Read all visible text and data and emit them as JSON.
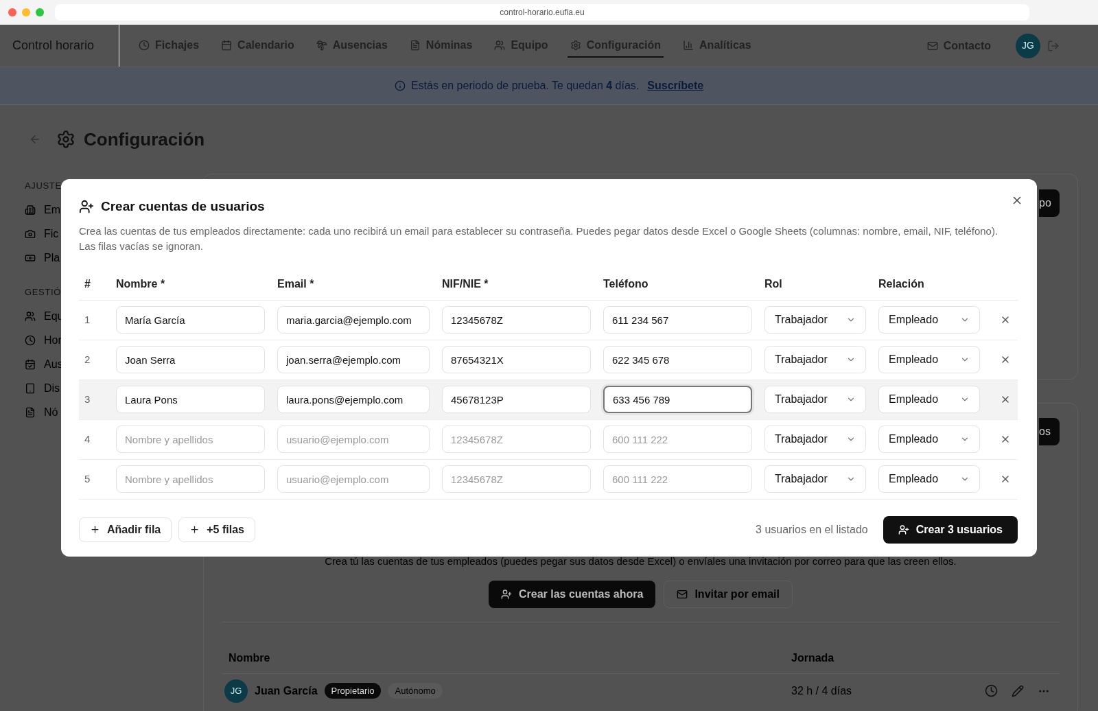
{
  "browser": {
    "url": "control-horario.eufia.eu"
  },
  "nav": {
    "brand": "Control horario",
    "items": [
      {
        "label": "Fichajes",
        "selected": false
      },
      {
        "label": "Calendario",
        "selected": false
      },
      {
        "label": "Ausencias",
        "selected": false
      },
      {
        "label": "Nóminas",
        "selected": false
      },
      {
        "label": "Equipo",
        "selected": false
      },
      {
        "label": "Configuración",
        "selected": true
      },
      {
        "label": "Analíticas",
        "selected": false
      }
    ],
    "contact": "Contacto",
    "avatar": "JG"
  },
  "banner": {
    "text": "Estás en periodo de prueba. Te quedan **4** días.",
    "link": "Suscríbete"
  },
  "page": {
    "title": "Configuración"
  },
  "sidebar": {
    "sections": [
      {
        "heading": "AJUSTE",
        "items": [
          "Em",
          "Fic",
          "Pla"
        ]
      },
      {
        "heading": "GESTIÓ",
        "items": [
          "Equ",
          "Hor",
          "Aus",
          "Dis",
          "Nó"
        ]
      }
    ]
  },
  "background_cards": [
    {
      "button": "po"
    },
    {
      "button": "os"
    }
  ],
  "team_section": {
    "description": "Crea tú las cuentas de tus empleados (puedes pegar sus datos desde Excel) o envíales una invitación por correo para que las creen ellos.",
    "buttons": [
      {
        "label": "Crear las cuentas ahora",
        "kind": "primary"
      },
      {
        "label": "Invitar por email",
        "kind": "secondary"
      }
    ],
    "columns": [
      "Nombre",
      "Jornada"
    ],
    "rows": [
      {
        "avatar": "JG",
        "name": "Juan García",
        "badges": [
          {
            "label": "Propietario",
            "kind": "dark"
          },
          {
            "label": "Autónomo",
            "kind": "light"
          }
        ],
        "jornada": "32 h / 4 días"
      }
    ]
  },
  "dialog": {
    "title": "Crear cuentas de usuarios",
    "description": "Crea las cuentas de tus empleados directamente: cada uno recibirá un email para establecer su contraseña. Puedes pegar datos desde Excel o Google Sheets (columnas: nombre, email, NIF, teléfono). Las filas vacías se ignoran.",
    "columns": [
      "#",
      "Nombre *",
      "Email *",
      "NIF/NIE *",
      "Teléfono",
      "Rol",
      "Relación"
    ],
    "rows": [
      {
        "number": "1",
        "highlighted": false,
        "nombre": {
          "value": "María García"
        },
        "email": {
          "value": "maria.garcia@ejemplo.com"
        },
        "nif": {
          "value": "12345678Z"
        },
        "telefono": {
          "value": "611 234 567",
          "focused": false
        },
        "rol": "Trabajador",
        "relacion": "Empleado"
      },
      {
        "number": "2",
        "highlighted": false,
        "nombre": {
          "value": "Joan Serra"
        },
        "email": {
          "value": "joan.serra@ejemplo.com"
        },
        "nif": {
          "value": "87654321X"
        },
        "telefono": {
          "value": "622 345 678",
          "focused": false
        },
        "rol": "Trabajador",
        "relacion": "Empleado"
      },
      {
        "number": "3",
        "highlighted": true,
        "nombre": {
          "value": "Laura Pons"
        },
        "email": {
          "value": "laura.pons@ejemplo.com"
        },
        "nif": {
          "value": "45678123P"
        },
        "telefono": {
          "value": "633 456 789",
          "focused": true
        },
        "rol": "Trabajador",
        "relacion": "Empleado"
      },
      {
        "number": "4",
        "highlighted": false,
        "nombre": {
          "placeholder": "Nombre y apellidos"
        },
        "email": {
          "placeholder": "usuario@ejemplo.com"
        },
        "nif": {
          "placeholder": "12345678Z"
        },
        "telefono": {
          "placeholder": "600 111 222",
          "focused": false
        },
        "rol": "Trabajador",
        "relacion": "Empleado"
      },
      {
        "number": "5",
        "highlighted": false,
        "nombre": {
          "placeholder": "Nombre y apellidos"
        },
        "email": {
          "placeholder": "usuario@ejemplo.com"
        },
        "nif": {
          "placeholder": "12345678Z"
        },
        "telefono": {
          "placeholder": "600 111 222",
          "focused": false
        },
        "rol": "Trabajador",
        "relacion": "Empleado"
      }
    ],
    "add_buttons": [
      "Añadir fila",
      "+5 filas"
    ],
    "count": "3 usuarios en el listado",
    "submit": "Crear 3 usuarios"
  }
}
